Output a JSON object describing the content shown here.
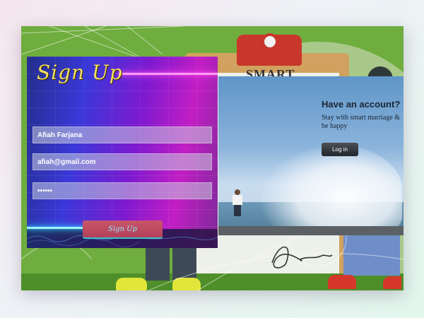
{
  "signup": {
    "title": "Sign Up",
    "name_value": "Afiah Farjana",
    "email_value": "afiah@gmail.com",
    "password_value": "••••••",
    "button_label": "Sign Up"
  },
  "login_panel": {
    "heading": "Have an account?",
    "subtext": "Stay with smart marriage & be happy",
    "button_label": "Log in"
  },
  "background": {
    "board_text": "SMART"
  },
  "colors": {
    "title": "#f3e25c",
    "background_green": "#6fad3e",
    "clip_red": "#c8372b",
    "neon_pink": "#ff4cf0",
    "neon_cyan": "#30d8ff"
  }
}
